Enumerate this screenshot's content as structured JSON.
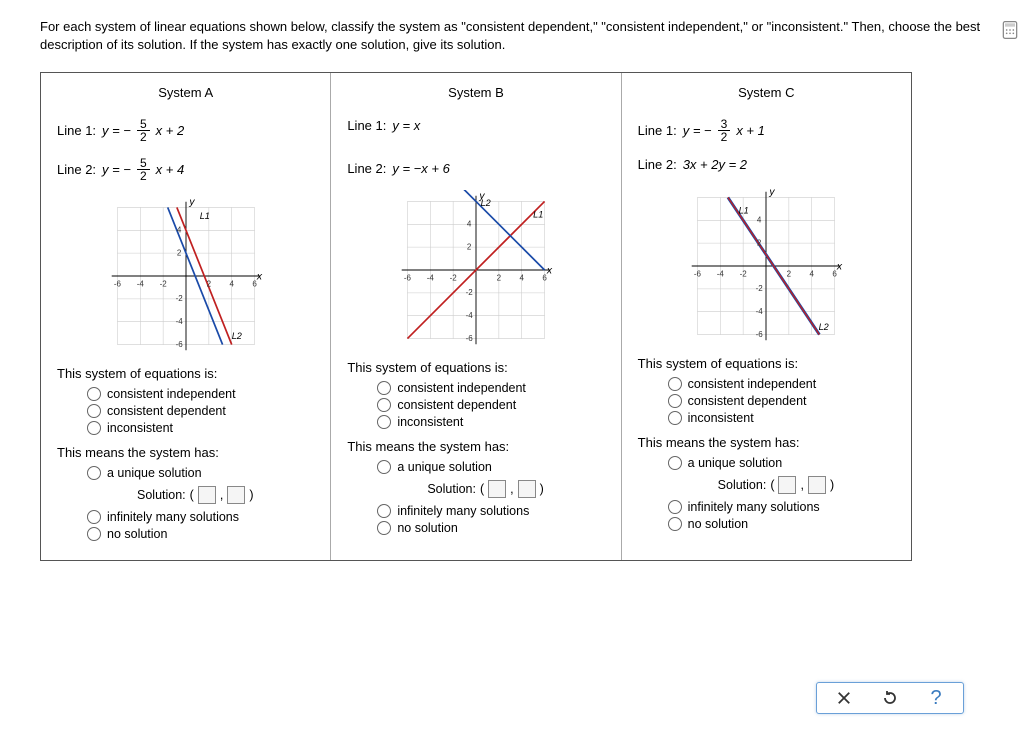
{
  "instructions": "For each system of linear equations shown below, classify the system as \"consistent dependent,\" \"consistent independent,\" or \"inconsistent.\" Then, choose the best description of its solution. If the system has exactly one solution, give its solution.",
  "labels": {
    "thisSystem": "This system of equations is:",
    "thisMeans": "This means the system has:",
    "consIndep": "consistent independent",
    "consDep": "consistent dependent",
    "inconsistent": "inconsistent",
    "unique": "a unique solution",
    "solution": "Solution:",
    "infMany": "infinitely many solutions",
    "noSol": "no solution",
    "line1": "Line 1:",
    "line2": "Line 2:"
  },
  "systems": {
    "A": {
      "title": "System A",
      "eq1_pre": "y = −",
      "eq1_num": "5",
      "eq1_den": "2",
      "eq1_post": "x + 2",
      "eq2_pre": "y = −",
      "eq2_num": "5",
      "eq2_den": "2",
      "eq2_post": "x + 4"
    },
    "B": {
      "title": "System B",
      "eq1": "y = x",
      "eq2": "y = −x + 6"
    },
    "C": {
      "title": "System C",
      "eq1_pre": "y = −",
      "eq1_num": "3",
      "eq1_den": "2",
      "eq1_post": "x + 1",
      "eq2": "3x + 2y = 2"
    }
  },
  "chart_data": [
    {
      "type": "line",
      "title": "System A graph",
      "xlim": [
        -6,
        6
      ],
      "ylim": [
        -6,
        6
      ],
      "xlabel": "x",
      "ylabel": "y",
      "ticks": [
        -6,
        -4,
        -2,
        2,
        4,
        6
      ],
      "series": [
        {
          "name": "L1",
          "slope": -2.5,
          "intercept": 2,
          "color": "#1a4aa8"
        },
        {
          "name": "L2",
          "slope": -2.5,
          "intercept": 4,
          "color": "#c02020"
        }
      ]
    },
    {
      "type": "line",
      "title": "System B graph",
      "xlim": [
        -6,
        6
      ],
      "ylim": [
        -6,
        6
      ],
      "xlabel": "x",
      "ylabel": "y",
      "ticks": [
        -6,
        -4,
        -2,
        2,
        4,
        6
      ],
      "series": [
        {
          "name": "L1",
          "slope": 1,
          "intercept": 0,
          "color": "#c02020"
        },
        {
          "name": "L2",
          "slope": -1,
          "intercept": 6,
          "color": "#1a4aa8"
        }
      ]
    },
    {
      "type": "line",
      "title": "System C graph",
      "xlim": [
        -6,
        6
      ],
      "ylim": [
        -6,
        6
      ],
      "xlabel": "x",
      "ylabel": "y",
      "ticks": [
        -6,
        -4,
        -2,
        2,
        4,
        6
      ],
      "series": [
        {
          "name": "L1",
          "slope": -1.5,
          "intercept": 1,
          "color": "#1a4aa8"
        },
        {
          "name": "L2",
          "slope": -1.5,
          "intercept": 1,
          "color": "#c02020"
        }
      ]
    }
  ]
}
